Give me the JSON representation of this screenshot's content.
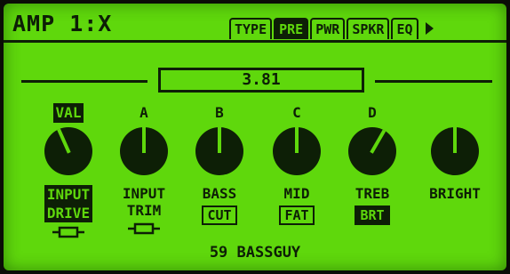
{
  "header": {
    "title": "AMP 1:X",
    "tabs": [
      {
        "label": "TYPE",
        "active": false
      },
      {
        "label": "PRE",
        "active": true
      },
      {
        "label": "PWR",
        "active": false
      },
      {
        "label": "SPKR",
        "active": false
      },
      {
        "label": "EQ",
        "active": false
      }
    ],
    "more_icon": "triangle-right-icon"
  },
  "value_display": "3.81",
  "knobs": [
    {
      "tag": "VAL",
      "label_lines": [
        "INPUT",
        "DRIVE"
      ],
      "extra": "link-icon",
      "level": 0.42
    },
    {
      "tag": "A",
      "label_lines": [
        "INPUT",
        "TRIM"
      ],
      "extra": "link-icon",
      "level": 0.5
    },
    {
      "tag": "B",
      "label_lines": [
        "BASS"
      ],
      "badge": "CUT",
      "level": 0.5
    },
    {
      "tag": "C",
      "label_lines": [
        "MID"
      ],
      "badge": "FAT",
      "level": 0.5
    },
    {
      "tag": "D",
      "label_lines": [
        "TREB"
      ],
      "badge": "BRT",
      "level": 0.6
    },
    {
      "tag": "",
      "label_lines": [
        "BRIGHT"
      ],
      "level": 0.5
    }
  ],
  "preset_name": "59 BASSGUY",
  "colors": {
    "screen": "#5fd80c",
    "ink": "#0d1f06"
  }
}
